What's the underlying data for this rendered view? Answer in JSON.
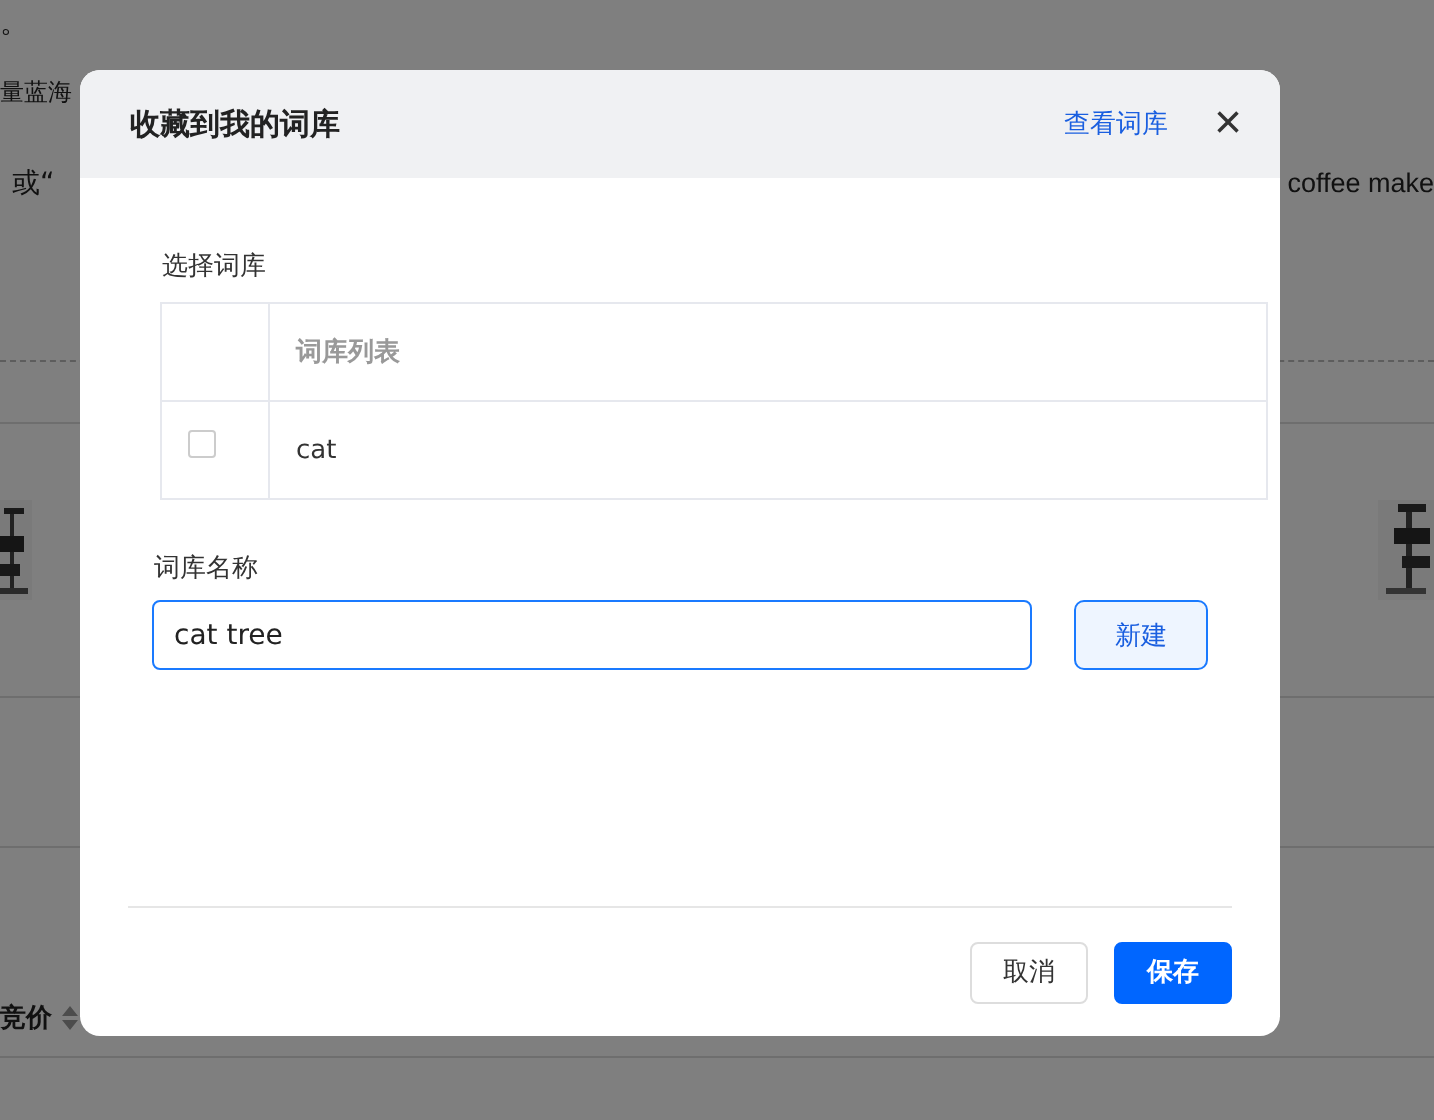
{
  "background_page": {
    "top_mark": "。",
    "snippet": "量蓝海",
    "row_left": "或“",
    "row_right": "coffee make",
    "column_header": "竞价"
  },
  "dialog": {
    "title": "收藏到我的词库",
    "link": "查看词库",
    "close": "×",
    "select_label": "选择词库",
    "table": {
      "columns": [
        "词库列表"
      ],
      "rows": [
        {
          "name": "cat",
          "checked": false
        }
      ]
    },
    "name_label": "词库名称",
    "name_input": {
      "value": "cat tree"
    },
    "create_button": "新建",
    "buttons": [
      {
        "label": "取消",
        "kind": "secondary"
      },
      {
        "label": "保存",
        "kind": "primary"
      }
    ]
  }
}
